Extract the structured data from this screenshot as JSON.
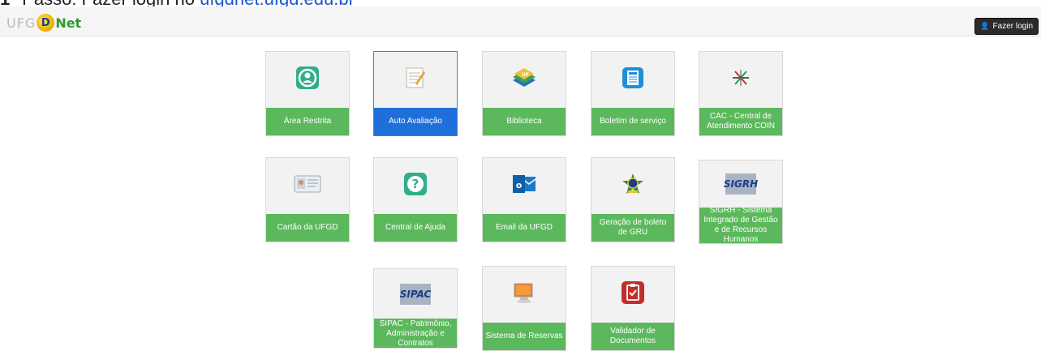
{
  "instruction": {
    "prefix": "Passo: Fazer login no ",
    "link": "ufgdnet.ufgd.edu.br"
  },
  "navbar": {
    "logo_uf": "UFG",
    "logo_d": "D",
    "logo_net": "Net",
    "login_label": "Fazer login"
  },
  "colors": {
    "tile_label_green": "#5cb85c",
    "tile_label_selected": "#1e6fd9",
    "tile_bg": "#f2f2f2"
  },
  "tiles": [
    {
      "label": "Área Restrita",
      "icon": "user-circle-icon"
    },
    {
      "label": "Auto Avaliação",
      "icon": "notepad-icon",
      "selected": true
    },
    {
      "label": "Biblioteca",
      "icon": "books-icon"
    },
    {
      "label": "Boletim de serviço",
      "icon": "newspaper-icon"
    },
    {
      "label": "CAC - Central de Atendimento COIN",
      "icon": "cac-logo-icon"
    },
    {
      "label": "Cartão da UFGD",
      "icon": "id-card-icon"
    },
    {
      "label": "Central de Ajuda",
      "icon": "question-icon"
    },
    {
      "label": "Email da UFGD",
      "icon": "outlook-icon"
    },
    {
      "label": "Geração de boleto de GRU",
      "icon": "brasao-icon"
    },
    {
      "label": "SIGRH - Sistema Integrado de Gestão e de Recursos Humanos",
      "icon": "sigrh-logo-icon",
      "logo_text": "SIGRH"
    },
    {
      "label": "SIPAC - Patrimônio, Administração e Contratos",
      "icon": "sipac-logo-icon",
      "logo_text": "SIPAC"
    },
    {
      "label": "Sistema de Reservas",
      "icon": "monitor-icon"
    },
    {
      "label": "Validador de Documentos",
      "icon": "clipboard-check-icon"
    }
  ]
}
